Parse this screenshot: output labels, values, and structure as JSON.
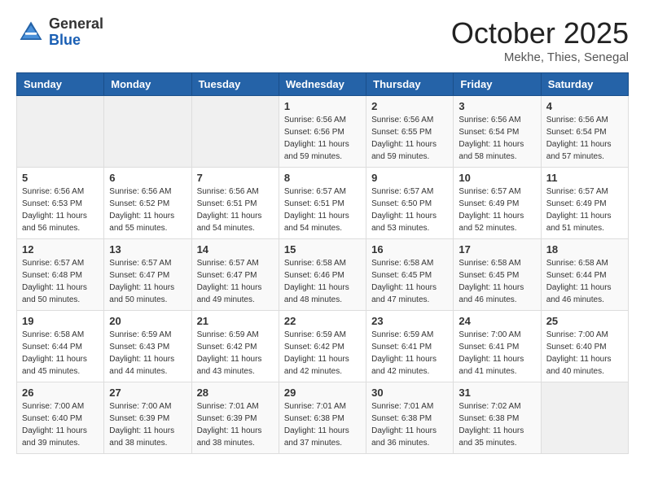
{
  "header": {
    "logo_general": "General",
    "logo_blue": "Blue",
    "month_title": "October 2025",
    "subtitle": "Mekhe, Thies, Senegal"
  },
  "weekdays": [
    "Sunday",
    "Monday",
    "Tuesday",
    "Wednesday",
    "Thursday",
    "Friday",
    "Saturday"
  ],
  "weeks": [
    [
      {
        "day": "",
        "info": ""
      },
      {
        "day": "",
        "info": ""
      },
      {
        "day": "",
        "info": ""
      },
      {
        "day": "1",
        "info": "Sunrise: 6:56 AM\nSunset: 6:56 PM\nDaylight: 11 hours\nand 59 minutes."
      },
      {
        "day": "2",
        "info": "Sunrise: 6:56 AM\nSunset: 6:55 PM\nDaylight: 11 hours\nand 59 minutes."
      },
      {
        "day": "3",
        "info": "Sunrise: 6:56 AM\nSunset: 6:54 PM\nDaylight: 11 hours\nand 58 minutes."
      },
      {
        "day": "4",
        "info": "Sunrise: 6:56 AM\nSunset: 6:54 PM\nDaylight: 11 hours\nand 57 minutes."
      }
    ],
    [
      {
        "day": "5",
        "info": "Sunrise: 6:56 AM\nSunset: 6:53 PM\nDaylight: 11 hours\nand 56 minutes."
      },
      {
        "day": "6",
        "info": "Sunrise: 6:56 AM\nSunset: 6:52 PM\nDaylight: 11 hours\nand 55 minutes."
      },
      {
        "day": "7",
        "info": "Sunrise: 6:56 AM\nSunset: 6:51 PM\nDaylight: 11 hours\nand 54 minutes."
      },
      {
        "day": "8",
        "info": "Sunrise: 6:57 AM\nSunset: 6:51 PM\nDaylight: 11 hours\nand 54 minutes."
      },
      {
        "day": "9",
        "info": "Sunrise: 6:57 AM\nSunset: 6:50 PM\nDaylight: 11 hours\nand 53 minutes."
      },
      {
        "day": "10",
        "info": "Sunrise: 6:57 AM\nSunset: 6:49 PM\nDaylight: 11 hours\nand 52 minutes."
      },
      {
        "day": "11",
        "info": "Sunrise: 6:57 AM\nSunset: 6:49 PM\nDaylight: 11 hours\nand 51 minutes."
      }
    ],
    [
      {
        "day": "12",
        "info": "Sunrise: 6:57 AM\nSunset: 6:48 PM\nDaylight: 11 hours\nand 50 minutes."
      },
      {
        "day": "13",
        "info": "Sunrise: 6:57 AM\nSunset: 6:47 PM\nDaylight: 11 hours\nand 50 minutes."
      },
      {
        "day": "14",
        "info": "Sunrise: 6:57 AM\nSunset: 6:47 PM\nDaylight: 11 hours\nand 49 minutes."
      },
      {
        "day": "15",
        "info": "Sunrise: 6:58 AM\nSunset: 6:46 PM\nDaylight: 11 hours\nand 48 minutes."
      },
      {
        "day": "16",
        "info": "Sunrise: 6:58 AM\nSunset: 6:45 PM\nDaylight: 11 hours\nand 47 minutes."
      },
      {
        "day": "17",
        "info": "Sunrise: 6:58 AM\nSunset: 6:45 PM\nDaylight: 11 hours\nand 46 minutes."
      },
      {
        "day": "18",
        "info": "Sunrise: 6:58 AM\nSunset: 6:44 PM\nDaylight: 11 hours\nand 46 minutes."
      }
    ],
    [
      {
        "day": "19",
        "info": "Sunrise: 6:58 AM\nSunset: 6:44 PM\nDaylight: 11 hours\nand 45 minutes."
      },
      {
        "day": "20",
        "info": "Sunrise: 6:59 AM\nSunset: 6:43 PM\nDaylight: 11 hours\nand 44 minutes."
      },
      {
        "day": "21",
        "info": "Sunrise: 6:59 AM\nSunset: 6:42 PM\nDaylight: 11 hours\nand 43 minutes."
      },
      {
        "day": "22",
        "info": "Sunrise: 6:59 AM\nSunset: 6:42 PM\nDaylight: 11 hours\nand 42 minutes."
      },
      {
        "day": "23",
        "info": "Sunrise: 6:59 AM\nSunset: 6:41 PM\nDaylight: 11 hours\nand 42 minutes."
      },
      {
        "day": "24",
        "info": "Sunrise: 7:00 AM\nSunset: 6:41 PM\nDaylight: 11 hours\nand 41 minutes."
      },
      {
        "day": "25",
        "info": "Sunrise: 7:00 AM\nSunset: 6:40 PM\nDaylight: 11 hours\nand 40 minutes."
      }
    ],
    [
      {
        "day": "26",
        "info": "Sunrise: 7:00 AM\nSunset: 6:40 PM\nDaylight: 11 hours\nand 39 minutes."
      },
      {
        "day": "27",
        "info": "Sunrise: 7:00 AM\nSunset: 6:39 PM\nDaylight: 11 hours\nand 38 minutes."
      },
      {
        "day": "28",
        "info": "Sunrise: 7:01 AM\nSunset: 6:39 PM\nDaylight: 11 hours\nand 38 minutes."
      },
      {
        "day": "29",
        "info": "Sunrise: 7:01 AM\nSunset: 6:38 PM\nDaylight: 11 hours\nand 37 minutes."
      },
      {
        "day": "30",
        "info": "Sunrise: 7:01 AM\nSunset: 6:38 PM\nDaylight: 11 hours\nand 36 minutes."
      },
      {
        "day": "31",
        "info": "Sunrise: 7:02 AM\nSunset: 6:38 PM\nDaylight: 11 hours\nand 35 minutes."
      },
      {
        "day": "",
        "info": ""
      }
    ]
  ]
}
